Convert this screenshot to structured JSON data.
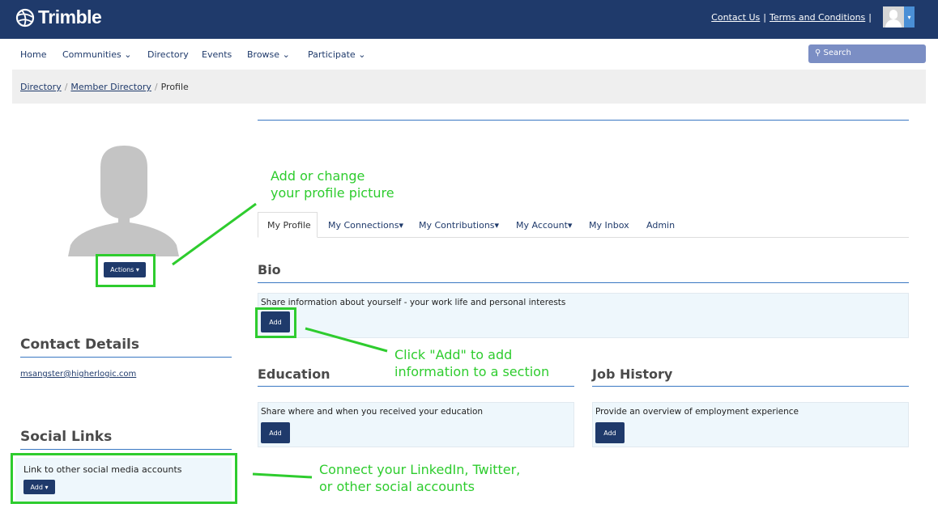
{
  "header": {
    "logo_text": "Trimble",
    "links": [
      "Contact Us",
      "Terms and Conditions"
    ]
  },
  "nav": {
    "items": [
      {
        "label": "Home",
        "caret": ""
      },
      {
        "label": "Communities",
        "caret": "⌄"
      },
      {
        "label": "Directory",
        "caret": ""
      },
      {
        "label": "Events",
        "caret": ""
      },
      {
        "label": "Browse",
        "caret": "⌄"
      },
      {
        "label": "Participate",
        "caret": "⌄"
      }
    ],
    "search_label": "Search"
  },
  "breadcrumb": [
    "Directory",
    "Member Directory",
    "Profile"
  ],
  "left": {
    "actions_label": "Actions ▾",
    "contact_heading": "Contact Details",
    "email": "msangster@higherlogic.com",
    "social_heading": "Social Links",
    "social_text": "Link to other social media accounts",
    "social_add_label": "Add ▾"
  },
  "tabs": [
    {
      "label": "My Profile"
    },
    {
      "label": "My Connections▾"
    },
    {
      "label": "My Contributions▾"
    },
    {
      "label": "My Account▾"
    },
    {
      "label": "My Inbox"
    },
    {
      "label": "Admin"
    }
  ],
  "sections": {
    "bio": {
      "heading": "Bio",
      "text": "Share information about yourself - your work life and personal interests",
      "add_label": "Add"
    },
    "education": {
      "heading": "Education",
      "text": "Share where and when you received your education",
      "add_label": "Add"
    },
    "job_history": {
      "heading": "Job History",
      "text": "Provide an overview of employment experience",
      "add_label": "Add"
    }
  },
  "annotations": {
    "picture": [
      "Add or change",
      "your profile picture"
    ],
    "add": [
      "Click \"Add\" to add",
      "information to a section"
    ],
    "social": [
      "Connect your LinkedIn, Twitter,",
      "or other social accounts"
    ]
  },
  "colors": {
    "brand": "#1f3a6b",
    "annotation": "#2ecc2e",
    "section_bg": "#eef7fc"
  }
}
